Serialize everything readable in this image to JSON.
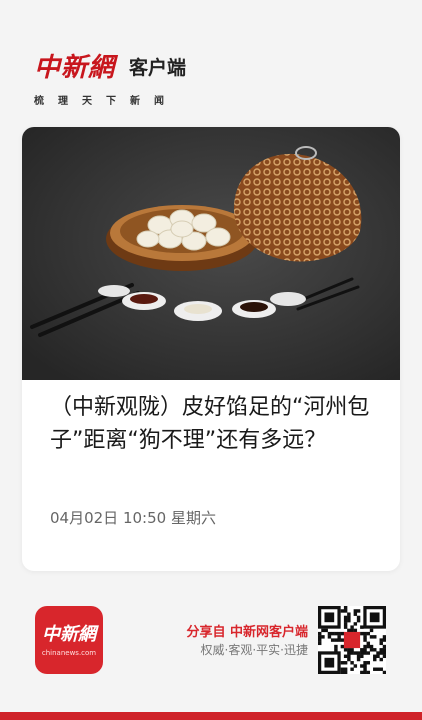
{
  "header": {
    "logo_text": "中新網",
    "app_name": "客户端",
    "slogan": "梳理天下新闻"
  },
  "article": {
    "image_alt": "photo-of-steamed-buns-with-dipping-sauces",
    "headline": "（中新观陇）皮好馅足的“河州包子”距离“狗不理”还有多远？",
    "date": "04月02日 10:50 星期六"
  },
  "footer": {
    "app_icon_logo": "中新網",
    "app_icon_domain": "chinanews.com",
    "share_prefix": "分享自",
    "share_source": "中新网客户端",
    "share_tagline": "权威·客观·平实·迅捷",
    "qr_icon": "qr-code-icon"
  },
  "colors": {
    "brand_red": "#c8161d",
    "accent_red": "#d8262c",
    "text_dark": "#1a1a1a",
    "text_muted": "#666666"
  }
}
